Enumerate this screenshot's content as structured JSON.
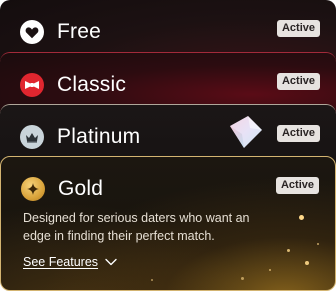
{
  "tiers": [
    {
      "id": "free",
      "name": "Free",
      "badge": "Active",
      "icon": "heart-icon",
      "icon_color": "#ffffff"
    },
    {
      "id": "classic",
      "name": "Classic",
      "badge": "Active",
      "icon": "bowtie-icon",
      "icon_color": "#e0262f"
    },
    {
      "id": "platinum",
      "name": "Platinum",
      "badge": "Active",
      "icon": "crown-icon",
      "icon_color": "#c9d4da"
    },
    {
      "id": "gold",
      "name": "Gold",
      "badge": "Active",
      "icon": "star-icon",
      "icon_color": "#d9a33a",
      "description": "Designed for serious daters who want an edge in finding their perfect match.",
      "see_features_label": "See Features"
    }
  ],
  "colors": {
    "classic_border": "#a32a3a",
    "platinum_border": "#b0a79a",
    "gold_border": "#d3b471",
    "badge_bg": "#e7e3e0"
  }
}
